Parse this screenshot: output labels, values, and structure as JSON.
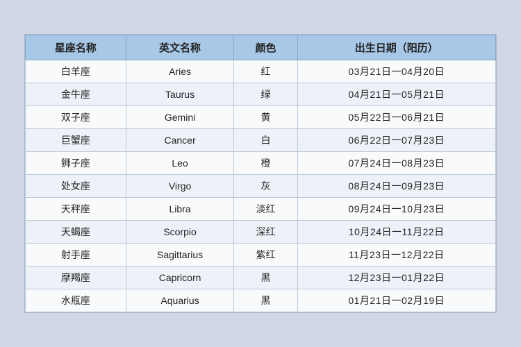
{
  "table": {
    "headers": [
      "星座名称",
      "英文名称",
      "颜色",
      "出生日期（阳历）"
    ],
    "rows": [
      {
        "chinese": "白羊座",
        "english": "Aries",
        "color": "红",
        "dates": "03月21日一04月20日"
      },
      {
        "chinese": "金牛座",
        "english": "Taurus",
        "color": "绿",
        "dates": "04月21日一05月21日"
      },
      {
        "chinese": "双子座",
        "english": "Gemini",
        "color": "黄",
        "dates": "05月22日一06月21日"
      },
      {
        "chinese": "巨蟹座",
        "english": "Cancer",
        "color": "白",
        "dates": "06月22日一07月23日"
      },
      {
        "chinese": "狮子座",
        "english": "Leo",
        "color": "橙",
        "dates": "07月24日一08月23日"
      },
      {
        "chinese": "处女座",
        "english": "Virgo",
        "color": "灰",
        "dates": "08月24日一09月23日"
      },
      {
        "chinese": "天秤座",
        "english": "Libra",
        "color": "淡红",
        "dates": "09月24日一10月23日"
      },
      {
        "chinese": "天蝎座",
        "english": "Scorpio",
        "color": "深红",
        "dates": "10月24日一11月22日"
      },
      {
        "chinese": "射手座",
        "english": "Sagittarius",
        "color": "紫红",
        "dates": "11月23日一12月22日"
      },
      {
        "chinese": "摩羯座",
        "english": "Capricorn",
        "color": "黑",
        "dates": "12月23日一01月22日"
      },
      {
        "chinese": "水瓶座",
        "english": "Aquarius",
        "color": "黑",
        "dates": "01月21日一02月19日"
      }
    ]
  }
}
